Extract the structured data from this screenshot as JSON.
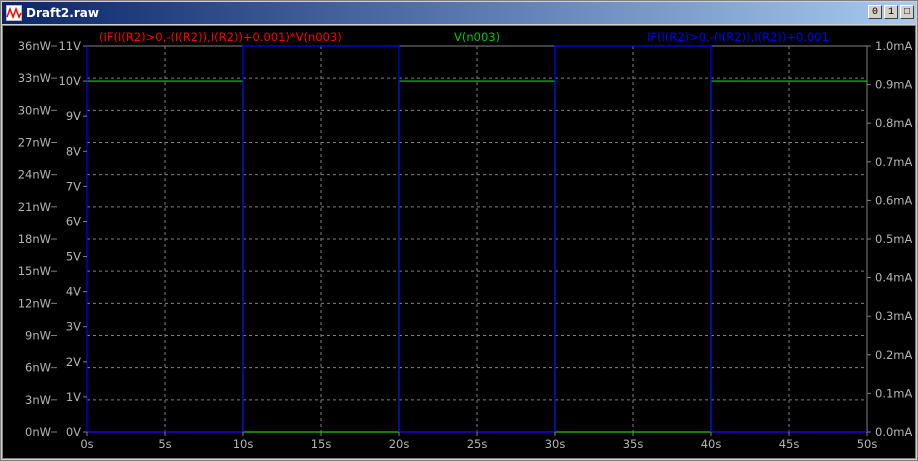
{
  "window": {
    "title": "Draft2.raw",
    "buttons": [
      "0",
      "1",
      "□"
    ]
  },
  "colors": {
    "background": "#000000",
    "grid": "#808080",
    "axis_text": "#b4b4b4",
    "trace_red": "#ff0000",
    "trace_green": "#00c800",
    "trace_blue": "#0000ff"
  },
  "chart_data": {
    "type": "line",
    "xlabel": "",
    "x_ticks": [
      "0s",
      "5s",
      "10s",
      "15s",
      "20s",
      "25s",
      "30s",
      "35s",
      "40s",
      "45s",
      "50s"
    ],
    "xlim": [
      0,
      50
    ],
    "left_axis_outer": {
      "unit": "nW",
      "ylim": [
        0,
        36
      ],
      "ticks": [
        "0nW",
        "3nW",
        "6nW",
        "9nW",
        "12nW",
        "15nW",
        "18nW",
        "21nW",
        "24nW",
        "27nW",
        "30nW",
        "33nW",
        "36nW"
      ]
    },
    "left_axis_inner": {
      "unit": "V",
      "ylim": [
        0,
        11
      ],
      "ticks": [
        "0V",
        "1V",
        "2V",
        "3V",
        "4V",
        "5V",
        "6V",
        "7V",
        "8V",
        "9V",
        "10V",
        "11V"
      ]
    },
    "right_axis": {
      "unit": "mA",
      "ylim": [
        0,
        1.0
      ],
      "ticks": [
        "0.0mA",
        "0.1mA",
        "0.2mA",
        "0.3mA",
        "0.4mA",
        "0.5mA",
        "0.6mA",
        "0.7mA",
        "0.8mA",
        "0.9mA",
        "1.0mA"
      ]
    },
    "grid": true,
    "series": [
      {
        "name": "(IF(I(R2)>0,-(I(R2)),I(R2))+0.001)*V(n003)",
        "color": "#ff0000",
        "axis": "left_axis_outer",
        "x": [
          0,
          50
        ],
        "y": [
          0,
          0
        ]
      },
      {
        "name": "V(n003)",
        "color": "#00c800",
        "axis": "left_axis_inner",
        "x": [
          0,
          10,
          10,
          20,
          20,
          30,
          30,
          40,
          40,
          50
        ],
        "y": [
          10,
          10,
          0,
          0,
          10,
          10,
          0,
          0,
          10,
          10
        ]
      },
      {
        "name": "IF(I(R2)>0,-(I(R2)),I(R2))+0.001",
        "color": "#0000ff",
        "axis": "right_axis",
        "x": [
          0,
          0,
          0,
          10,
          10,
          20,
          20,
          30,
          30,
          40,
          40,
          50
        ],
        "y": [
          0,
          1.0,
          0,
          0,
          1.0,
          1.0,
          0,
          0,
          1.0,
          1.0,
          0,
          0
        ]
      }
    ]
  }
}
